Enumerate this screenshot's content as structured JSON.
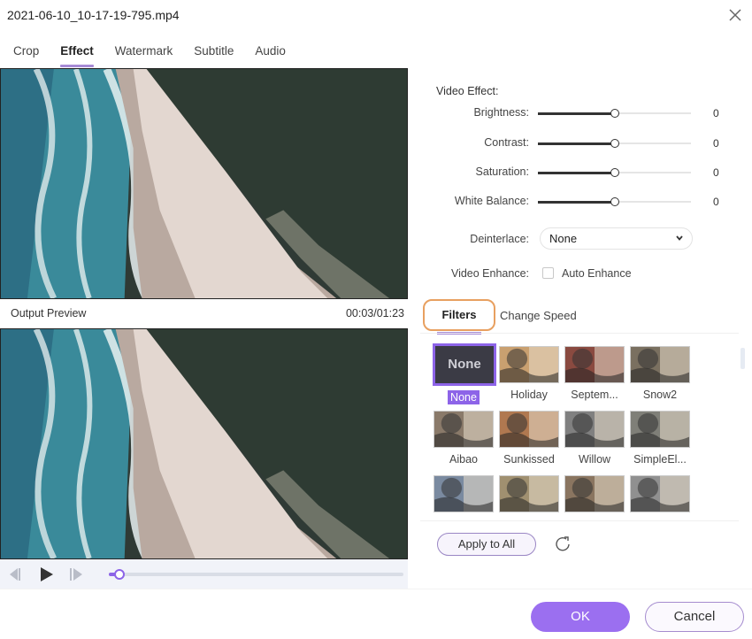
{
  "window": {
    "title": "2021-06-10_10-17-19-795.mp4",
    "close_icon": "close-icon"
  },
  "tabs": [
    {
      "label": "Crop",
      "active": false
    },
    {
      "label": "Effect",
      "active": true
    },
    {
      "label": "Watermark",
      "active": false
    },
    {
      "label": "Subtitle",
      "active": false
    },
    {
      "label": "Audio",
      "active": false
    }
  ],
  "preview": {
    "output_label": "Output Preview",
    "time": "00:03/01:23",
    "progress_fraction": 0.036
  },
  "video_effect": {
    "title": "Video Effect:",
    "sliders": [
      {
        "label": "Brightness:",
        "value": "0",
        "position_fraction": 0.5
      },
      {
        "label": "Contrast:",
        "value": "0",
        "position_fraction": 0.5
      },
      {
        "label": "Saturation:",
        "value": "0",
        "position_fraction": 0.5
      },
      {
        "label": "White Balance:",
        "value": "0",
        "position_fraction": 0.5
      }
    ],
    "deinterlace": {
      "label": "Deinterlace:",
      "selected": "None"
    },
    "enhance": {
      "label": "Video Enhance:",
      "checkbox_label": "Auto Enhance",
      "checked": false
    }
  },
  "subtabs": {
    "filters": "Filters",
    "change_speed": "Change Speed"
  },
  "filters": [
    {
      "name": "None",
      "thumb_text": "None",
      "selected": true
    },
    {
      "name": "Holiday",
      "tint": "#c9a070"
    },
    {
      "name": "Septem...",
      "tint": "#8a4a40"
    },
    {
      "name": "Snow2",
      "tint": "#7a7060"
    },
    {
      "name": "Aibao",
      "tint": "#8a7a6a"
    },
    {
      "name": "Sunkissed",
      "tint": "#b07850"
    },
    {
      "name": "Willow",
      "tint": "#808080"
    },
    {
      "name": "SimpleEl...",
      "tint": "#7f7f78"
    },
    {
      "name": "",
      "tint": "#7a8aa0"
    },
    {
      "name": "",
      "tint": "#a09070"
    },
    {
      "name": "",
      "tint": "#8a7560"
    },
    {
      "name": "",
      "tint": "#909090"
    }
  ],
  "actions": {
    "apply_all": "Apply to All",
    "ok": "OK",
    "cancel": "Cancel"
  },
  "colors": {
    "accent": "#9b6ff0",
    "filters_tab_border": "#e8a060"
  }
}
